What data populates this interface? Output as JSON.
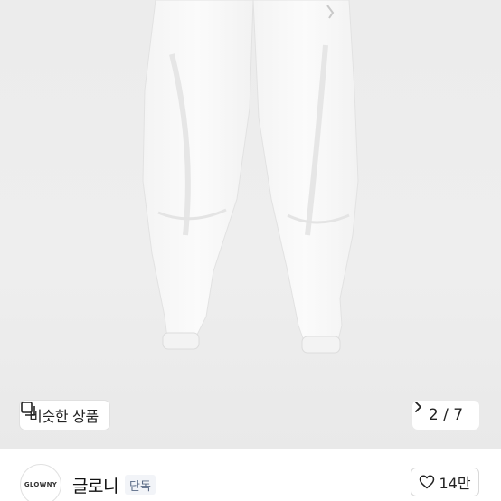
{
  "gallery": {
    "similar_label": "비슷한 상품",
    "page_indicator": "2 / 7"
  },
  "brand": {
    "logo_text": "GLOWNY",
    "name": "글로니",
    "badge": "단독",
    "likes": "14만"
  },
  "colors": {
    "image_bg": "#ececec",
    "badge_bg": "#f2f4f8",
    "badge_text": "#5b6b86"
  },
  "icons": [
    "similar-products-icon",
    "chevron-right-icon",
    "heart-icon"
  ]
}
